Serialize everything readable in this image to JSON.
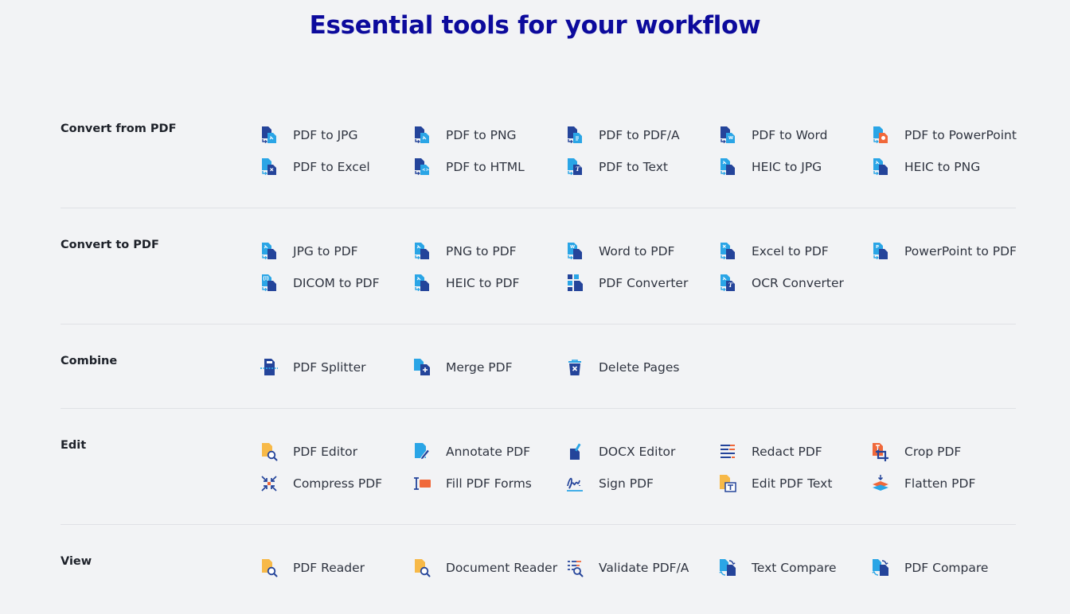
{
  "page": {
    "title": "Essential tools for your workflow"
  },
  "colors": {
    "title": "#0c0a9c",
    "dark_blue": "#24449a",
    "light_blue": "#2aa5e6",
    "orange": "#f0683a",
    "yellow": "#f7b948",
    "divider": "#dfe1e5"
  },
  "sections": [
    {
      "id": "convert-from-pdf",
      "label": "Convert from PDF",
      "tools": [
        {
          "label": "PDF to JPG",
          "icon": "pdf-to-jpg-icon"
        },
        {
          "label": "PDF to PNG",
          "icon": "pdf-to-png-icon"
        },
        {
          "label": "PDF to PDF/A",
          "icon": "pdf-to-pdfa-icon"
        },
        {
          "label": "PDF to Word",
          "icon": "pdf-to-word-icon"
        },
        {
          "label": "PDF to PowerPoint",
          "icon": "pdf-to-powerpoint-icon"
        },
        {
          "label": "PDF to Excel",
          "icon": "pdf-to-excel-icon"
        },
        {
          "label": "PDF to HTML",
          "icon": "pdf-to-html-icon"
        },
        {
          "label": "PDF to Text",
          "icon": "pdf-to-text-icon"
        },
        {
          "label": "HEIC to JPG",
          "icon": "heic-to-jpg-icon"
        },
        {
          "label": "HEIC to PNG",
          "icon": "heic-to-png-icon"
        }
      ]
    },
    {
      "id": "convert-to-pdf",
      "label": "Convert to PDF",
      "tools": [
        {
          "label": "JPG to PDF",
          "icon": "jpg-to-pdf-icon"
        },
        {
          "label": "PNG to PDF",
          "icon": "png-to-pdf-icon"
        },
        {
          "label": "Word to PDF",
          "icon": "word-to-pdf-icon"
        },
        {
          "label": "Excel to PDF",
          "icon": "excel-to-pdf-icon"
        },
        {
          "label": "PowerPoint to PDF",
          "icon": "powerpoint-to-pdf-icon"
        },
        {
          "label": "DICOM to PDF",
          "icon": "dicom-to-pdf-icon"
        },
        {
          "label": "HEIC to PDF",
          "icon": "heic-to-pdf-icon"
        },
        {
          "label": "PDF Converter",
          "icon": "pdf-converter-icon"
        },
        {
          "label": "OCR Converter",
          "icon": "ocr-converter-icon"
        }
      ]
    },
    {
      "id": "combine",
      "label": "Combine",
      "tools": [
        {
          "label": "PDF Splitter",
          "icon": "pdf-splitter-icon"
        },
        {
          "label": "Merge PDF",
          "icon": "merge-pdf-icon"
        },
        {
          "label": "Delete Pages",
          "icon": "delete-pages-icon"
        }
      ]
    },
    {
      "id": "edit",
      "label": "Edit",
      "tools": [
        {
          "label": "PDF Editor",
          "icon": "pdf-editor-icon"
        },
        {
          "label": "Annotate PDF",
          "icon": "annotate-pdf-icon"
        },
        {
          "label": "DOCX Editor",
          "icon": "docx-editor-icon"
        },
        {
          "label": "Redact PDF",
          "icon": "redact-pdf-icon"
        },
        {
          "label": "Crop PDF",
          "icon": "crop-pdf-icon"
        },
        {
          "label": "Compress PDF",
          "icon": "compress-pdf-icon"
        },
        {
          "label": "Fill PDF Forms",
          "icon": "fill-pdf-forms-icon"
        },
        {
          "label": "Sign PDF",
          "icon": "sign-pdf-icon"
        },
        {
          "label": "Edit PDF Text",
          "icon": "edit-pdf-text-icon"
        },
        {
          "label": "Flatten PDF",
          "icon": "flatten-pdf-icon"
        }
      ]
    },
    {
      "id": "view",
      "label": "View",
      "tools": [
        {
          "label": "PDF Reader",
          "icon": "pdf-reader-icon"
        },
        {
          "label": "Document Reader",
          "icon": "document-reader-icon"
        },
        {
          "label": "Validate PDF/A",
          "icon": "validate-pdfa-icon"
        },
        {
          "label": "Text Compare",
          "icon": "text-compare-icon"
        },
        {
          "label": "PDF Compare",
          "icon": "pdf-compare-icon"
        }
      ]
    }
  ]
}
